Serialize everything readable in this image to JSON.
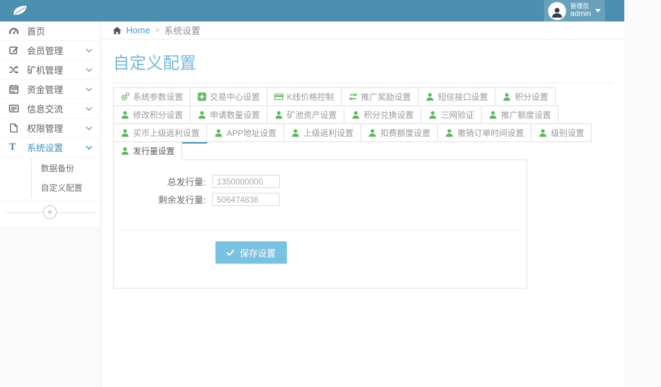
{
  "topbar": {
    "logo_icon": "leaf-icon",
    "user": {
      "role": "管理员",
      "name": "admin",
      "avatar_icon": "person-icon",
      "caret_icon": "caret-down-icon"
    }
  },
  "sidebar": {
    "items": [
      {
        "label": "首页",
        "icon": "dashboard-icon",
        "has_submenu": false,
        "active": false
      },
      {
        "label": "会员管理",
        "icon": "edit-icon",
        "has_submenu": true,
        "active": false
      },
      {
        "label": "矿机管理",
        "icon": "shuffle-icon",
        "has_submenu": true,
        "active": false
      },
      {
        "label": "资金管理",
        "icon": "calendar-icon",
        "has_submenu": true,
        "active": false
      },
      {
        "label": "信息交流",
        "icon": "newspaper-icon",
        "has_submenu": true,
        "active": false
      },
      {
        "label": "权限管理",
        "icon": "file-icon",
        "has_submenu": true,
        "active": false
      },
      {
        "label": "系统设置",
        "icon": "text-T-icon",
        "has_submenu": true,
        "active": true
      }
    ],
    "submenu": [
      {
        "label": "数据备份",
        "active": false
      },
      {
        "label": "自定义配置",
        "active": true
      }
    ],
    "collapse_icon": "«"
  },
  "breadcrumb": {
    "home_icon": "home-icon",
    "home": "Home",
    "separator": ">",
    "current": "系统设置"
  },
  "page": {
    "title": "自定义配置"
  },
  "tabs": {
    "rows": [
      {
        "items": [
          {
            "label": "系统参数设置",
            "icon": "cogs-icon"
          },
          {
            "label": "交易中心设置",
            "icon": "plus-square-icon"
          },
          {
            "label": "K线价格控制",
            "icon": "credit-card-icon"
          },
          {
            "label": "推广奖励设置",
            "icon": "exchange-icon"
          },
          {
            "label": "短信接口设置",
            "icon": "user-icon"
          },
          {
            "label": "积分设置",
            "icon": "user-icon"
          }
        ]
      },
      {
        "items": [
          {
            "label": "修改积分设置",
            "icon": "user-icon"
          },
          {
            "label": "申请数量设置",
            "icon": "user-icon"
          },
          {
            "label": "矿池资产设置",
            "icon": "user-icon"
          },
          {
            "label": "积分兑换设置",
            "icon": "user-icon"
          },
          {
            "label": "三网验证",
            "icon": "user-icon"
          },
          {
            "label": "推广额度设置",
            "icon": "user-icon"
          }
        ]
      },
      {
        "items": [
          {
            "label": "买币上级返利设置",
            "icon": "user-icon",
            "underlined": true
          },
          {
            "label": "APP地址设置",
            "icon": "user-icon"
          },
          {
            "label": "上级返利设置",
            "icon": "user-icon"
          },
          {
            "label": "扣费额度设置",
            "icon": "user-icon"
          },
          {
            "label": "撤销订单时间设置",
            "icon": "user-icon"
          },
          {
            "label": "级别设置",
            "icon": "user-icon"
          }
        ]
      },
      {
        "items": [
          {
            "label": "发行量设置",
            "icon": "user-icon",
            "active": true
          }
        ]
      }
    ]
  },
  "form": {
    "fields": [
      {
        "label": "总发行量:",
        "value": "1350000000"
      },
      {
        "label": "剩余发行量:",
        "value": "506474836"
      }
    ],
    "save_button": {
      "label": "保存设置",
      "icon": "check-icon"
    }
  },
  "colors": {
    "topbar_blue": "#4d8fb0",
    "accent_blue": "#4a90b5",
    "title_blue": "#76b9d8",
    "link_blue": "#4c9cc6",
    "sidebar_active_blue": "#4193c1",
    "tab_icon_green": "#5cb85c",
    "save_button_blue": "#79c2e1"
  }
}
